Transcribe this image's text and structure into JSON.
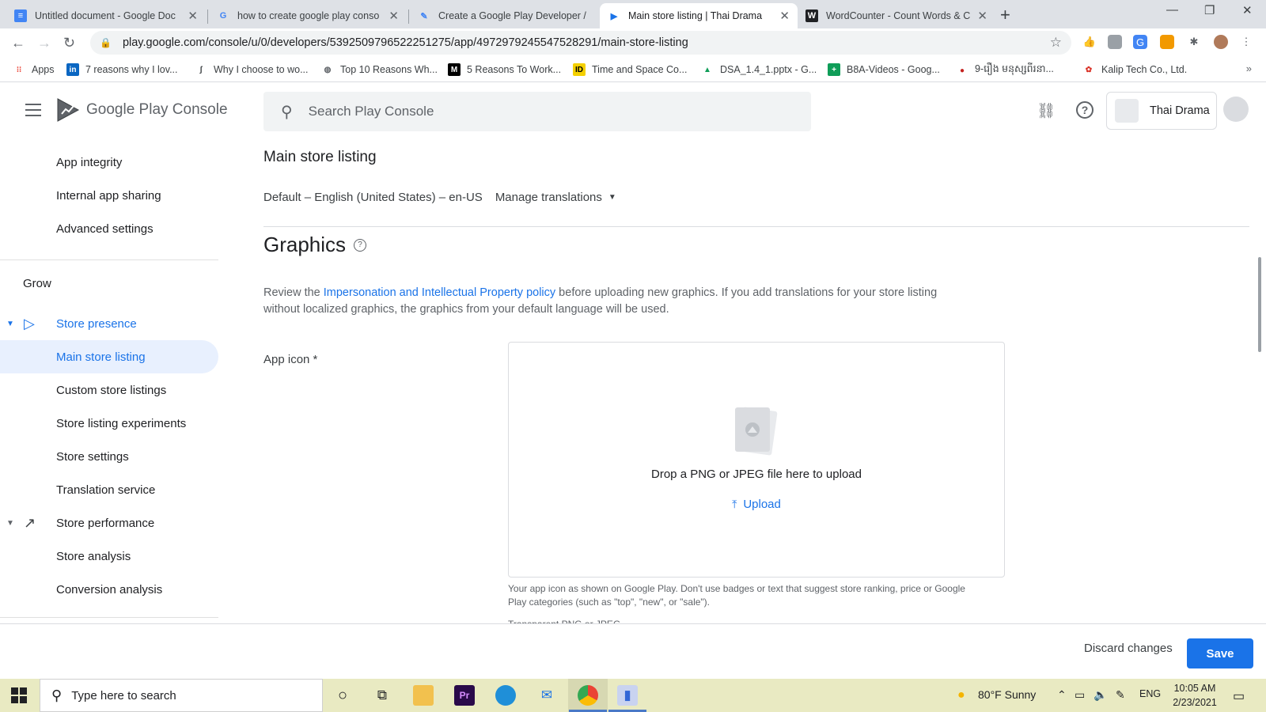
{
  "browser": {
    "tabs": [
      {
        "title": "Untitled document - Google Doc",
        "icon": "docs-icon",
        "color": "#4285f4"
      },
      {
        "title": "how to create google play conso",
        "icon": "google-icon",
        "color": "#4285f4"
      },
      {
        "title": "Create a Google Play Developer /",
        "icon": "feather-icon",
        "color": "#4285f4"
      },
      {
        "title": "Main store listing | Thai Drama",
        "icon": "play-console-icon",
        "color": "#1a73e8"
      },
      {
        "title": "WordCounter - Count Words & C",
        "icon": "w-icon",
        "color": "#202124"
      }
    ],
    "url": "play.google.com/console/u/0/developers/5392509796522251275/app/4972979245547528291/main-store-listing",
    "bookmarks": [
      {
        "label": "Apps",
        "icon": "apps-grid-icon"
      },
      {
        "label": "7 reasons why I lov...",
        "icon": "linkedin-icon"
      },
      {
        "label": "Why I choose to wo...",
        "icon": "loop-icon"
      },
      {
        "label": "Top 10 Reasons Wh...",
        "icon": "globe-icon"
      },
      {
        "label": "5 Reasons To Work...",
        "icon": "medium-icon"
      },
      {
        "label": "Time and Space Co...",
        "icon": "id-icon"
      },
      {
        "label": "DSA_1.4_1.pptx - G...",
        "icon": "drive-icon"
      },
      {
        "label": "B8A-Videos - Goog...",
        "icon": "sheets-icon"
      },
      {
        "label": "9-រឿង មនុស្សពីរនា...",
        "icon": "khmer-site-icon"
      },
      {
        "label": "Kalip Tech Co., Ltd.",
        "icon": "kalip-icon"
      }
    ]
  },
  "console": {
    "brand_main": "Google Play",
    "brand_sub": "Console",
    "search_placeholder": "Search Play Console",
    "app_name": "Thai Drama"
  },
  "sidebar": {
    "items_top": [
      "App integrity",
      "Internal app sharing",
      "Advanced settings"
    ],
    "group_label": "Grow",
    "store_presence": "Store presence",
    "store_presence_items": [
      "Main store listing",
      "Custom store listings",
      "Store listing experiments",
      "Store settings",
      "Translation service"
    ],
    "store_performance": "Store performance",
    "store_performance_items": [
      "Store analysis",
      "Conversion analysis"
    ]
  },
  "main": {
    "title": "Main store listing",
    "language": "Default – English (United States) – en-US",
    "manage_translations": "Manage translations",
    "graphics_title": "Graphics",
    "desc_before": "Review the ",
    "desc_link": "Impersonation and Intellectual Property policy",
    "desc_after": " before uploading new graphics. If you add translations for your store listing without localized graphics, the graphics from your default language will be used.",
    "app_icon_label": "App icon  *",
    "drop_text": "Drop a PNG or JPEG file here to upload",
    "upload_label": "Upload",
    "hint": "Your app icon as shown on Google Play. Don't use badges or text that suggest store ranking, price or Google Play categories (such as \"top\", \"new\", or \"sale\").",
    "hint2": "Transparent PNG or JPEG"
  },
  "footer": {
    "discard": "Discard changes",
    "save": "Save"
  },
  "taskbar": {
    "search_placeholder": "Type here to search",
    "weather": "80°F  Sunny",
    "lang": "ENG",
    "time": "10:05 AM",
    "date": "2/23/2021"
  },
  "colors": {
    "accent": "#1a73e8",
    "active_nav_bg": "#e8f0fe",
    "taskbar": "#e9eac2"
  }
}
